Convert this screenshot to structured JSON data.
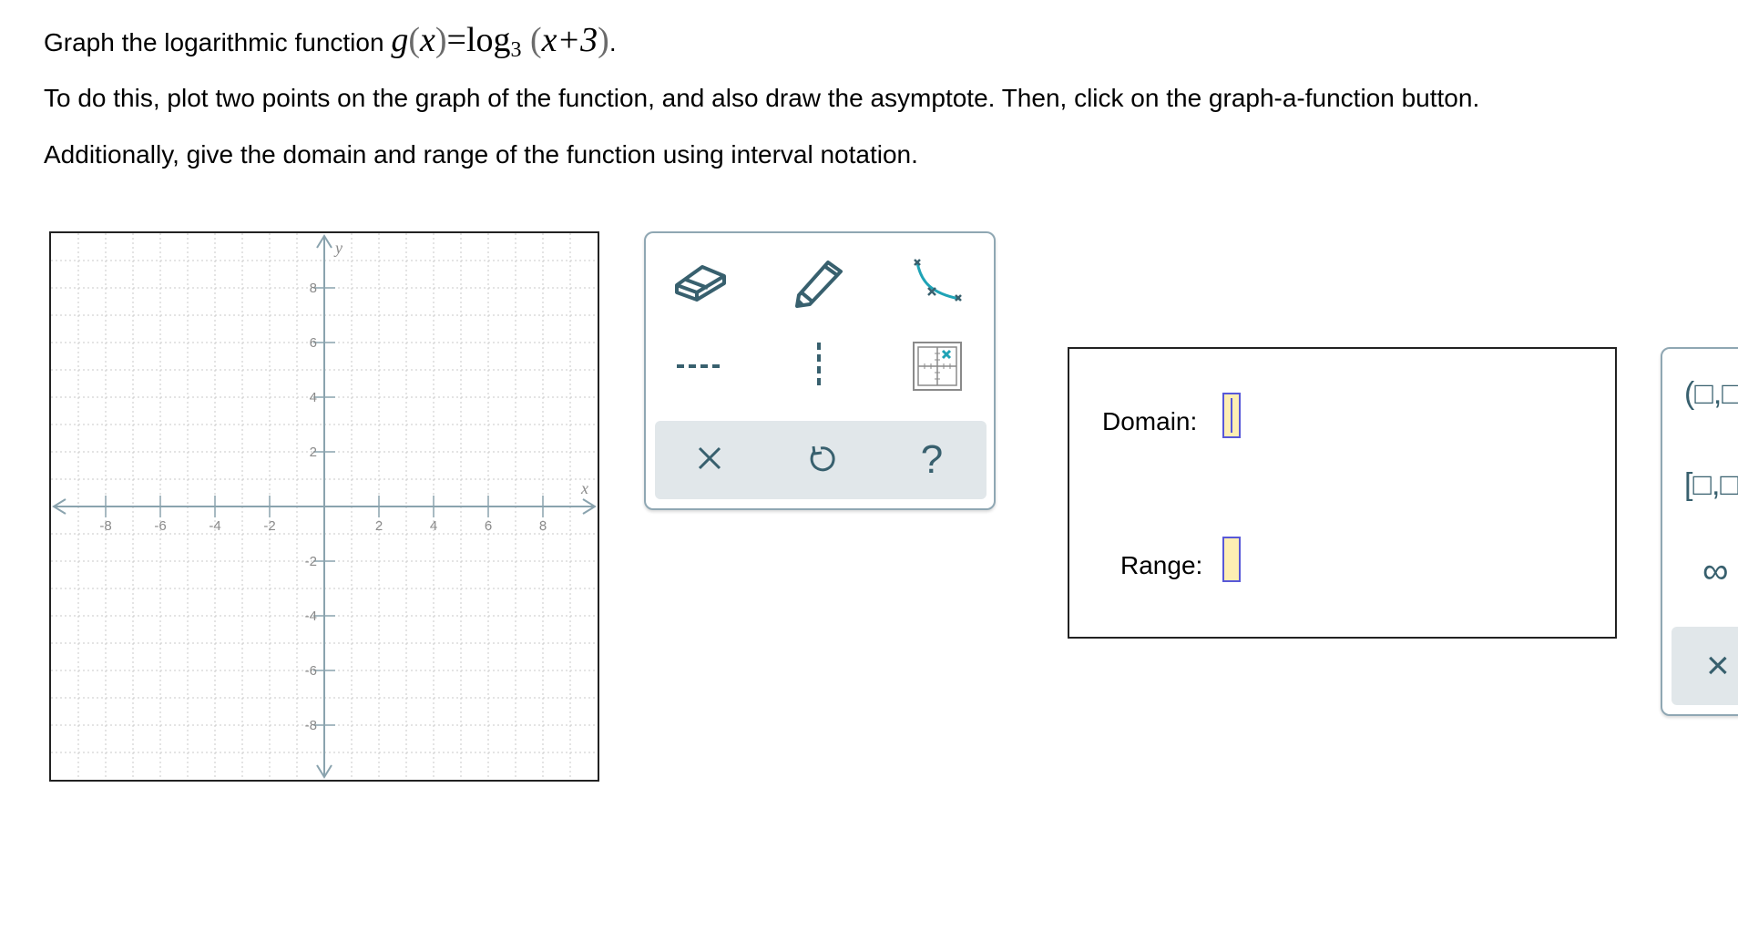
{
  "question": {
    "line1_text": "Graph the logarithmic function",
    "func_name": "g",
    "func_var": "x",
    "func_rhs_log": "log",
    "func_base": "3",
    "func_arg": "x+3",
    "func_period": ".",
    "line2": "To do this, plot two points on the graph of the function, and also draw the asymptote. Then, click on the graph-a-function button.",
    "line3": "Additionally, give the domain and range of the function using interval notation."
  },
  "graph": {
    "x_axis_label": "x",
    "y_axis_label": "y",
    "x_range": [
      -10,
      10
    ],
    "y_range": [
      -10,
      10
    ],
    "grid": "dotted, step 1",
    "x_ticks": [
      "-8",
      "-6",
      "-4",
      "-2",
      "2",
      "4",
      "6",
      "8"
    ],
    "y_ticks": [
      "8",
      "6",
      "4",
      "2",
      "-2",
      "-4",
      "-6",
      "-8"
    ],
    "colors": {
      "axis": "#8aa3ae",
      "grid": "#c8c8c8",
      "labels": "#8a8a8a"
    }
  },
  "toolbox": {
    "tools": [
      {
        "name": "eraser-icon"
      },
      {
        "name": "pencil-icon"
      },
      {
        "name": "graph-function-icon"
      },
      {
        "name": "horizontal-asymptote-icon"
      },
      {
        "name": "vertical-asymptote-icon"
      },
      {
        "name": "point-grid-icon"
      }
    ],
    "actions": [
      {
        "name": "clear-icon"
      },
      {
        "name": "undo-icon"
      },
      {
        "name": "help-icon",
        "glyph": "?"
      }
    ],
    "colors": {
      "icon": "#38606e",
      "accent": "#1fa3b6",
      "border": "#8fa7b3",
      "bar": "#e1e7ea"
    }
  },
  "domain_range": {
    "domain_label": "Domain:",
    "range_label": "Range:",
    "domain_value": "",
    "range_value": "",
    "input_colors": {
      "border": "#5858d8",
      "fill": "#fdeeb3"
    }
  },
  "keypad": {
    "open_interval": "(□,□",
    "closed_interval": "[□,□",
    "infinity": "∞",
    "clear": "×"
  }
}
